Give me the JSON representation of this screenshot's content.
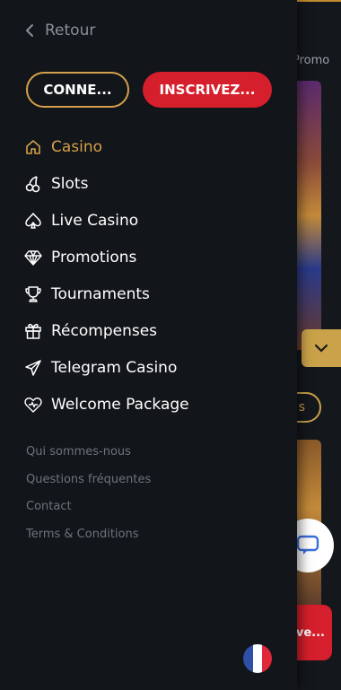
{
  "background": {
    "promo_text": "Promo",
    "pill_text": "s",
    "signup_text": "ve..."
  },
  "drawer": {
    "back_label": "Retour",
    "login_label": "CONNE...",
    "signup_label": "INSCRIVEZ...",
    "nav": [
      {
        "label": "Casino",
        "icon": "home-icon",
        "active": true
      },
      {
        "label": "Slots",
        "icon": "cherries-icon",
        "active": false
      },
      {
        "label": "Live Casino",
        "icon": "spade-icon",
        "active": false
      },
      {
        "label": "Promotions",
        "icon": "diamond-icon",
        "active": false
      },
      {
        "label": "Tournaments",
        "icon": "trophy-icon",
        "active": false
      },
      {
        "label": "Récompenses",
        "icon": "gift-icon",
        "active": false
      },
      {
        "label": "Telegram Casino",
        "icon": "paper-plane-icon",
        "active": false
      },
      {
        "label": "Welcome Package",
        "icon": "heart-icon",
        "active": false
      }
    ],
    "footer_links": [
      "Qui sommes-nous",
      "Questions fréquentes",
      "Contact",
      "Terms & Conditions"
    ],
    "language_flag": "france-flag-icon"
  },
  "colors": {
    "accent_gold": "#d4a04a",
    "signup_red": "#d61f2c",
    "drawer_bg": "#121519"
  }
}
